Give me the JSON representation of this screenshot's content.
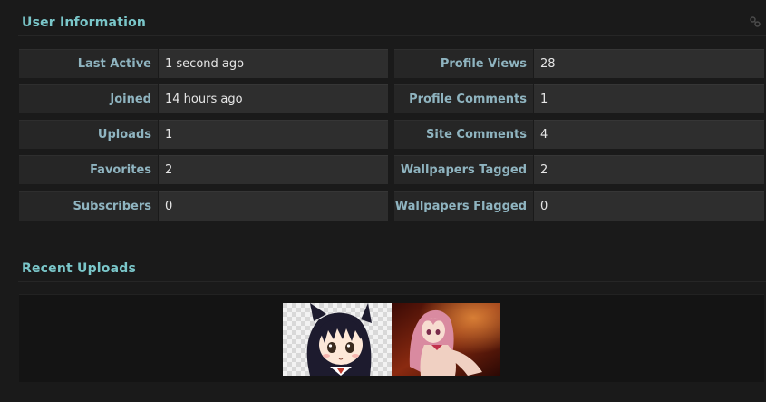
{
  "user_info": {
    "title": "User Information",
    "left_rows": [
      {
        "label": "Last Active",
        "value": "1 second ago"
      },
      {
        "label": "Joined",
        "value": "14 hours ago"
      },
      {
        "label": "Uploads",
        "value": "1"
      },
      {
        "label": "Favorites",
        "value": "2"
      },
      {
        "label": "Subscribers",
        "value": "0"
      }
    ],
    "right_rows": [
      {
        "label": "Profile Views",
        "value": "28"
      },
      {
        "label": "Profile Comments",
        "value": "1"
      },
      {
        "label": "Site Comments",
        "value": "4"
      },
      {
        "label": "Wallpapers Tagged",
        "value": "2"
      },
      {
        "label": "Wallpapers Flagged",
        "value": "0"
      }
    ]
  },
  "recent_uploads": {
    "title": "Recent Uploads",
    "thumbnails": [
      {
        "icon": "anime-cat-girl-thumbnail"
      },
      {
        "icon": "anime-pink-hair-girl-thumbnail"
      }
    ]
  },
  "colors": {
    "background": "#1a1a1a",
    "section_title": "#7ac6c9",
    "label_text": "#8fb4c0",
    "label_bg": "#262626",
    "value_bg": "#2e2e2e"
  }
}
